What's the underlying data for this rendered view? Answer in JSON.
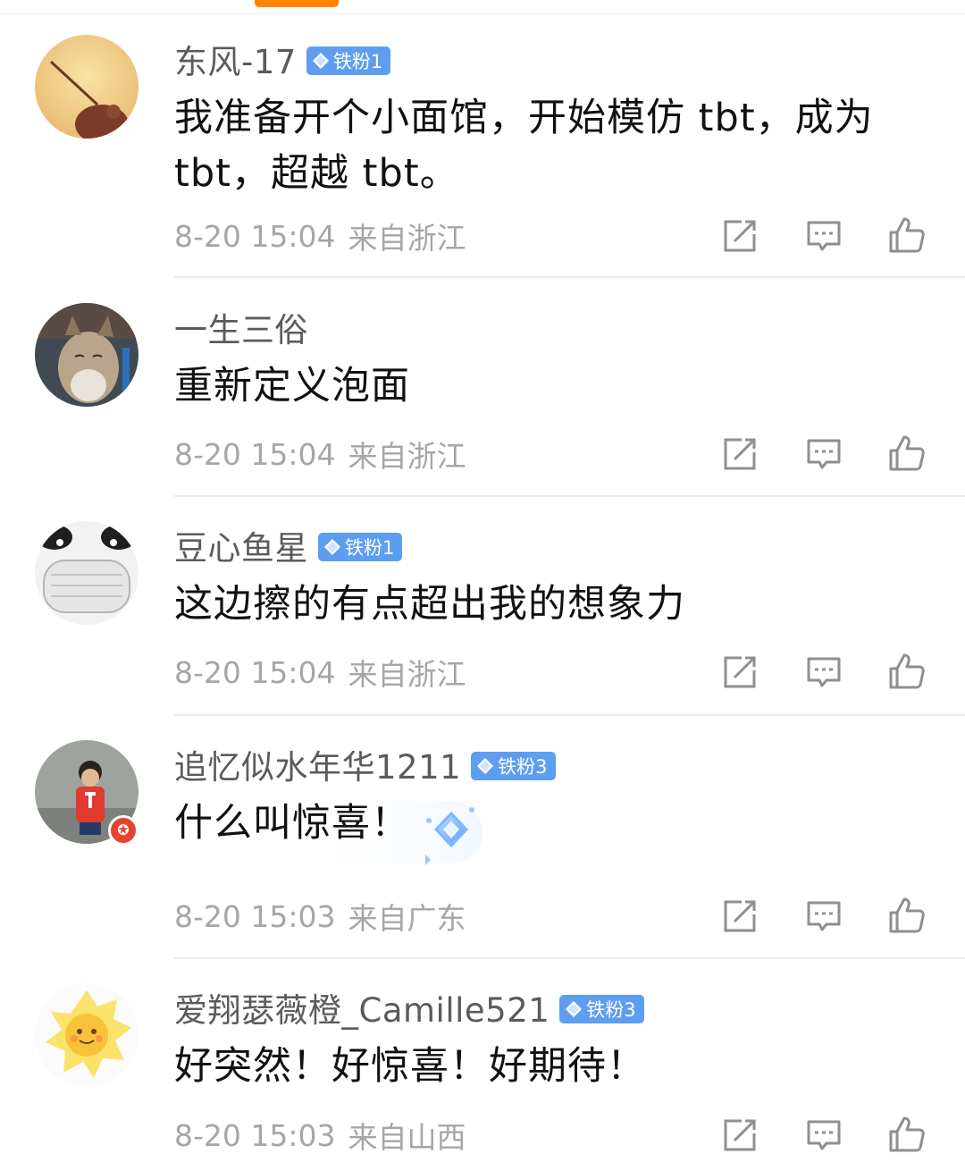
{
  "comments": [
    {
      "username": "东风-17",
      "fan_badge": "铁粉1",
      "text": "我准备开个小面馆，开始模仿 tbt，成为 tbt，超越 tbt。",
      "time": "8-20 15:04",
      "location": "来自浙江"
    },
    {
      "username": "一生三俗",
      "fan_badge": "",
      "text": "重新定义泡面",
      "time": "8-20 15:04",
      "location": "来自浙江"
    },
    {
      "username": "豆心鱼星",
      "fan_badge": "铁粉1",
      "text": "这边擦的有点超出我的想象力",
      "time": "8-20 15:04",
      "location": "来自浙江"
    },
    {
      "username": "追忆似水年华1211",
      "fan_badge": "铁粉3",
      "text": "什么叫惊喜！",
      "time": "8-20 15:03",
      "location": "来自广东"
    },
    {
      "username": "爱翔瑟薇橙_Camille521",
      "fan_badge": "铁粉3",
      "text": "好突然！好惊喜！好期待！",
      "time": "8-20 15:03",
      "location": "来自山西"
    }
  ],
  "icons": {
    "repost": "share-edit-icon",
    "comment": "comment-bubble-icon",
    "like": "thumbs-up-icon",
    "badge": "diamond-gem-icon"
  },
  "colors": {
    "accent": "#ff8200",
    "badge": "#5e9ef0",
    "username": "#5b5b5b",
    "meta": "#a6a6a6",
    "text": "#111111"
  }
}
